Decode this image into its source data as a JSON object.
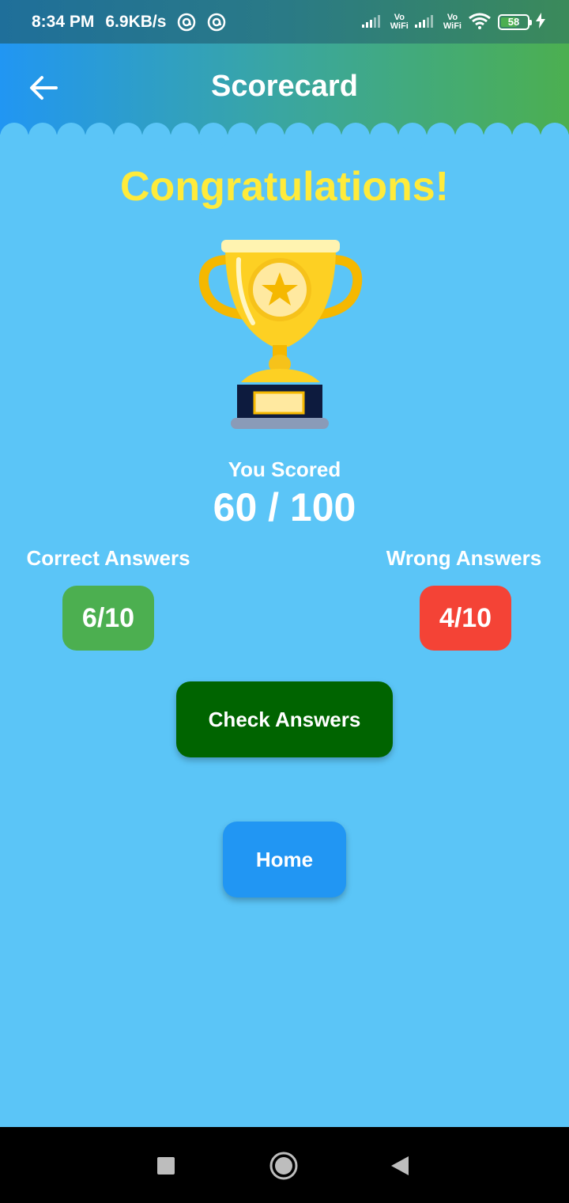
{
  "status_bar": {
    "time": "8:34 PM",
    "speed": "6.9KB/s",
    "vo_wifi_1_top": "Vo",
    "vo_wifi_1_bottom": "WiFi",
    "vo_wifi_2_top": "Vo",
    "vo_wifi_2_bottom": "WiFi",
    "battery_level": "58"
  },
  "app_bar": {
    "title": "Scorecard",
    "back_icon": "arrow-left-icon",
    "colors": {
      "start": "#2196f3",
      "end": "#4caf50"
    }
  },
  "main": {
    "heading": "Congratulations!",
    "trophy_icon": "trophy-icon",
    "score_label": "You Scored",
    "score_value": "60 / 100",
    "correct_label": "Correct Answers",
    "correct_value": "6/10",
    "wrong_label": "Wrong Answers",
    "wrong_value": "4/10",
    "check_answers_label": "Check Answers",
    "home_label": "Home",
    "colors": {
      "background": "#5bc5f7",
      "heading": "#ffeb3b",
      "correct": "#4caf50",
      "wrong": "#f44336",
      "check_button": "#006400",
      "home_button": "#2196f3"
    }
  },
  "nav_bar": {
    "recent_icon": "square-recent-icon",
    "home_icon": "circle-home-icon",
    "back_icon": "triangle-back-icon"
  }
}
